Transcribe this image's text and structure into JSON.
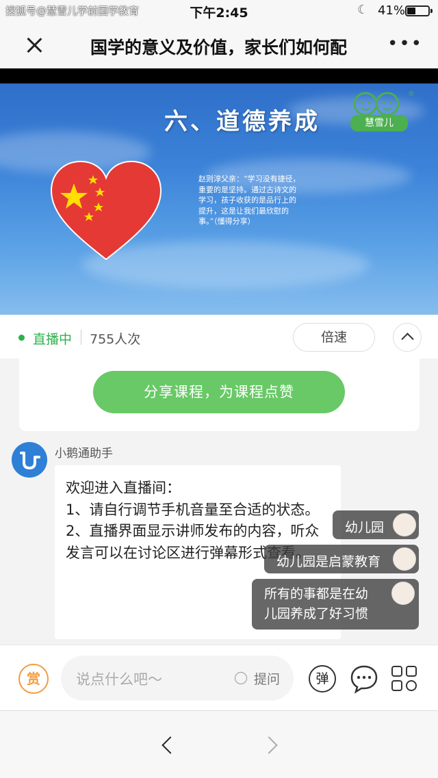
{
  "status_bar": {
    "watermark": "搜狐号@慧雪儿学前国学教育",
    "time": "下午2:45",
    "battery": "41%",
    "battery_level": 0.41
  },
  "nav": {
    "title": "国学的意义及价值，家长们如何配"
  },
  "slide": {
    "title": "六、道德养成",
    "logo_text": "慧雪儿",
    "quote": "赵则淳父亲：“学习没有捷径，重要的是坚持。通过古诗文的学习，孩子收获的是品行上的提升，这是让我们最欣慰的事。”（懂得分享）"
  },
  "live": {
    "status": "直播中",
    "viewers": "755人次",
    "speed_label": "倍速"
  },
  "share": {
    "button_label": "分享课程，为课程点赞"
  },
  "chat": {
    "sender": "小鹅通助手",
    "lines": [
      "欢迎进入直播间：",
      "1、请自行调节手机音量至合适的状态。",
      "2、直播界面显示讲师发布的内容，听众发言可以在讨论区进行弹幕形式查看。"
    ]
  },
  "danmaku": [
    {
      "text": "幼儿园"
    },
    {
      "text": "幼儿园是启蒙教育"
    },
    {
      "text": "所有的事都是在幼儿园养成了好习惯"
    }
  ],
  "input_bar": {
    "reward_label": "赏",
    "placeholder": "说点什么吧～",
    "ask_label": "提问",
    "danmaku_label": "弹"
  },
  "colors": {
    "live_green": "#2bb24c",
    "share_green": "#68c966",
    "reward_orange": "#f39c3d",
    "bot_blue": "#2e7fd6"
  }
}
